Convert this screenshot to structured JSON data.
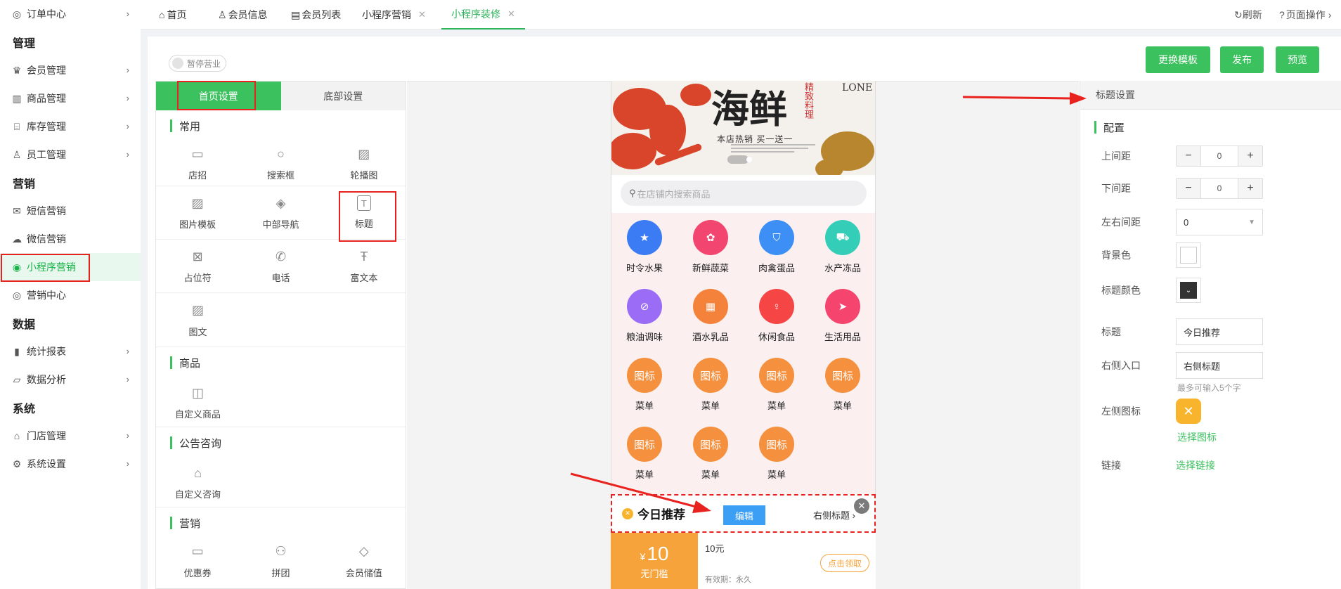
{
  "sidebar": {
    "items": [
      {
        "label": "订单中心",
        "icon": "globe-icon",
        "type": "item",
        "chevron": true
      },
      {
        "label": "管理",
        "type": "group"
      },
      {
        "label": "会员管理",
        "icon": "crown-icon",
        "type": "item",
        "chevron": true
      },
      {
        "label": "商品管理",
        "icon": "grid-icon",
        "type": "item",
        "chevron": true
      },
      {
        "label": "库存管理",
        "icon": "box-icon",
        "type": "item",
        "chevron": true
      },
      {
        "label": "员工管理",
        "icon": "user-icon",
        "type": "item",
        "chevron": true
      },
      {
        "label": "营销",
        "type": "group"
      },
      {
        "label": "短信营销",
        "icon": "mail-icon",
        "type": "item"
      },
      {
        "label": "微信营销",
        "icon": "wechat-icon",
        "type": "item"
      },
      {
        "label": "小程序营销",
        "icon": "miniprogram-icon",
        "type": "item",
        "active": true
      },
      {
        "label": "营销中心",
        "icon": "target-icon",
        "type": "item"
      },
      {
        "label": "数据",
        "type": "group"
      },
      {
        "label": "统计报表",
        "icon": "bar-chart-icon",
        "type": "item",
        "chevron": true
      },
      {
        "label": "数据分析",
        "icon": "line-chart-icon",
        "type": "item",
        "chevron": true
      },
      {
        "label": "系统",
        "type": "group"
      },
      {
        "label": "门店管理",
        "icon": "store-icon",
        "type": "item",
        "chevron": true
      },
      {
        "label": "系统设置",
        "icon": "gear-icon",
        "type": "item",
        "chevron": true
      }
    ]
  },
  "tabs": [
    {
      "label": "首页",
      "icon": "home-icon"
    },
    {
      "label": "会员信息",
      "icon": "user-icon"
    },
    {
      "label": "会员列表",
      "icon": "list-icon"
    },
    {
      "label": "小程序营销",
      "closable": true
    },
    {
      "label": "小程序装修",
      "closable": true,
      "active": true
    }
  ],
  "topbar": {
    "refresh": "刷新",
    "page_ops": "页面操作"
  },
  "toolbar": {
    "pause": "暂停营业",
    "change_template": "更换模板",
    "publish": "发布",
    "preview": "预览"
  },
  "left_panel": {
    "tab_home": "首页设置",
    "tab_bottom": "底部设置",
    "sections": {
      "common": "常用",
      "goods": "商品",
      "notice": "公告咨询",
      "marketing": "营销"
    },
    "common_items": [
      "店招",
      "搜索框",
      "轮播图",
      "图片模板",
      "中部导航",
      "标题",
      "占位符",
      "电话",
      "富文本",
      "图文"
    ],
    "goods_items": [
      "自定义商品"
    ],
    "notice_items": [
      "自定义咨询"
    ],
    "marketing_items": [
      "优惠券",
      "拼团",
      "会员储值"
    ]
  },
  "phone": {
    "banner": {
      "big": "海鲜",
      "side": "精致料理",
      "tag": "本店热销 买一送一",
      "corner": "LONE"
    },
    "search_placeholder": "在店铺内搜索商品",
    "nav_items": [
      {
        "label": "时令水果",
        "color": "#3b7cf5"
      },
      {
        "label": "新鲜蔬菜",
        "color": "#f2456f"
      },
      {
        "label": "肉禽蛋品",
        "color": "#3d8ff5"
      },
      {
        "label": "水产冻品",
        "color": "#34cdb7"
      },
      {
        "label": "粮油调味",
        "color": "#9b6cf5"
      },
      {
        "label": "酒水乳品",
        "color": "#f5823a"
      },
      {
        "label": "休闲食品",
        "color": "#f54545"
      },
      {
        "label": "生活用品",
        "color": "#f5456e"
      },
      {
        "label": "菜单",
        "color": "#f5913e",
        "text": "图标"
      },
      {
        "label": "菜单",
        "color": "#f5913e",
        "text": "图标"
      },
      {
        "label": "菜单",
        "color": "#f5913e",
        "text": "图标"
      },
      {
        "label": "菜单",
        "color": "#f5913e",
        "text": "图标"
      },
      {
        "label": "菜单",
        "color": "#f5913e",
        "text": "图标"
      },
      {
        "label": "菜单",
        "color": "#f5913e",
        "text": "图标"
      },
      {
        "label": "菜单",
        "color": "#f5913e",
        "text": "图标"
      }
    ],
    "title_block": {
      "title": "今日推荐",
      "edit": "编辑",
      "right": "右侧标题"
    },
    "coupon": {
      "currency": "¥",
      "amount": "10",
      "condition": "无门槛",
      "name": "10元",
      "validity": "有效期：永久",
      "claim": "点击领取"
    }
  },
  "right_panel": {
    "header": "标题设置",
    "config": "配置",
    "margin_top": {
      "label": "上间距",
      "value": "0"
    },
    "margin_bottom": {
      "label": "下间距",
      "value": "0"
    },
    "lr_margin": {
      "label": "左右间距",
      "value": "0"
    },
    "bg_color": {
      "label": "背景色"
    },
    "title_color": {
      "label": "标题颜色"
    },
    "title": {
      "label": "标题",
      "value": "今日推荐"
    },
    "right_entry": {
      "label": "右侧入口",
      "value": "右侧标题",
      "hint": "最多可输入5个字"
    },
    "left_icon": {
      "label": "左侧图标",
      "link": "选择图标"
    },
    "link": {
      "label": "链接",
      "link": "选择链接"
    }
  },
  "colors": {
    "accent": "#3cc15f",
    "danger": "#e8231f",
    "coupon": "#f7a33b",
    "edit": "#3ba0f5"
  }
}
